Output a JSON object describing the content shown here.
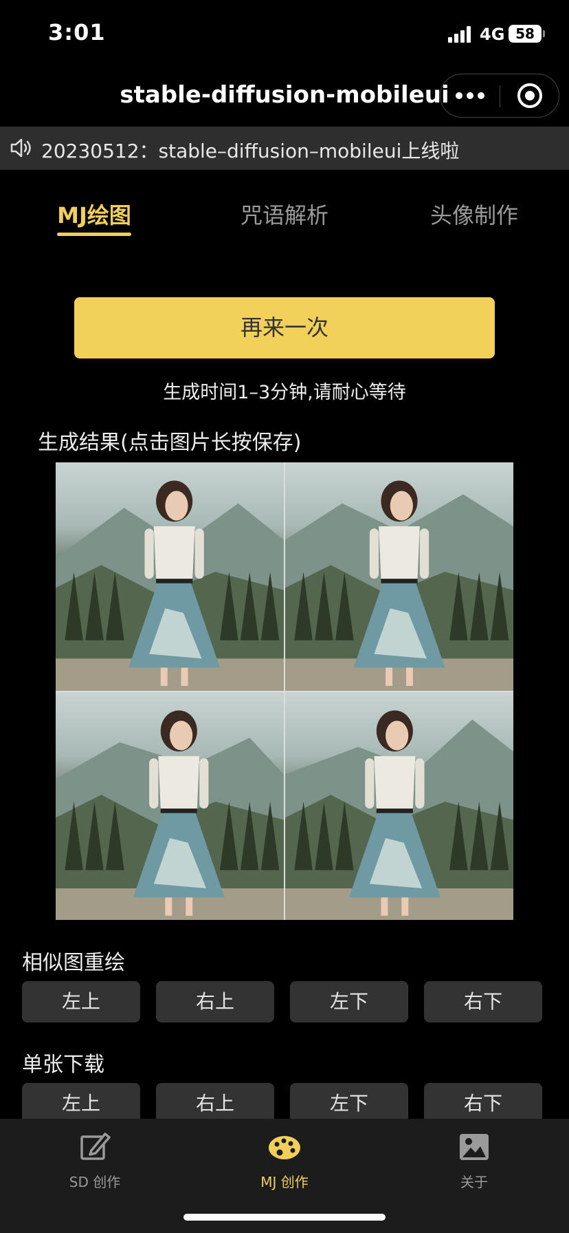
{
  "status_bar": {
    "time": "3:01",
    "network": "4G",
    "battery": "58"
  },
  "nav": {
    "title": "stable-diffusion-mobileui",
    "more_icon": "more-dots-icon",
    "close_icon": "target-icon"
  },
  "notice": {
    "icon": "speaker-icon",
    "text": "20230512：stable–diffusion–mobileui上线啦"
  },
  "tabs": [
    {
      "label": "MJ绘图",
      "active": true
    },
    {
      "label": "咒语解析",
      "active": false
    },
    {
      "label": "头像制作",
      "active": false
    }
  ],
  "main": {
    "retry_button": "再来一次",
    "hint": "生成时间1–3分钟,请耐心等待",
    "result_title": "生成结果(点击图片长按保存)"
  },
  "result_images": [
    {
      "position": "top-left"
    },
    {
      "position": "top-right"
    },
    {
      "position": "bottom-left"
    },
    {
      "position": "bottom-right"
    }
  ],
  "redraw": {
    "title": "相似图重绘",
    "buttons": [
      "左上",
      "右上",
      "左下",
      "右下"
    ]
  },
  "download": {
    "title": "单张下载",
    "buttons": [
      "左上",
      "右上",
      "左下",
      "右下"
    ]
  },
  "tabbar": [
    {
      "label": "SD 创作",
      "icon": "edit-icon",
      "active": false
    },
    {
      "label": "MJ 创作",
      "icon": "palette-icon",
      "active": true
    },
    {
      "label": "关于",
      "icon": "image-icon",
      "active": false
    }
  ],
  "colors": {
    "accent": "#f2cf5b",
    "button_bg": "#333333",
    "notice_bg": "#2e2e2e",
    "tabbar_bg": "#1c1c1c"
  }
}
